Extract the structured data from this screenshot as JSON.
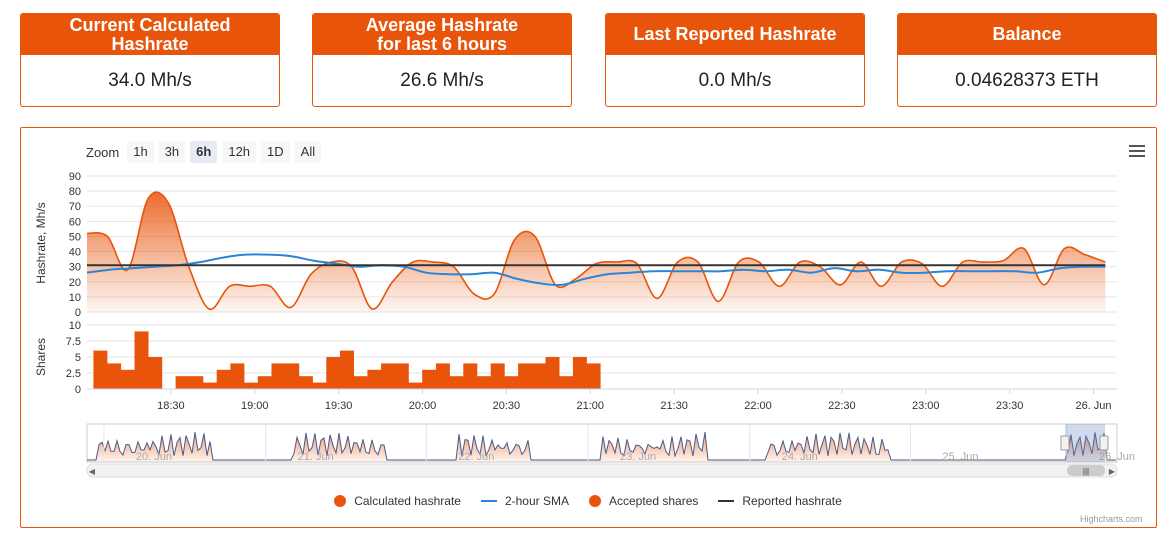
{
  "stats": [
    {
      "title": "Current Calculated\nHashrate",
      "value": "34.0 Mh/s"
    },
    {
      "title": "Average Hashrate\nfor last 6 hours",
      "value": "26.6 Mh/s"
    },
    {
      "title": "Last Reported Hashrate",
      "value": "0.0 Mh/s"
    },
    {
      "title": "Balance",
      "value": "0.04628373 ETH"
    }
  ],
  "zoom": {
    "label": "Zoom",
    "buttons": [
      "1h",
      "3h",
      "6h",
      "12h",
      "1D",
      "All"
    ],
    "selected": "6h"
  },
  "colors": {
    "accent": "#e8540a",
    "sma": "#2a85d8",
    "reported": "#333333"
  },
  "chart_data": {
    "type": "area",
    "x_ticks": [
      "18:30",
      "19:00",
      "19:30",
      "20:00",
      "20:30",
      "21:00",
      "21:30",
      "22:00",
      "22:30",
      "23:00",
      "23:30",
      "26. Jun"
    ],
    "hashrate_panel": {
      "ylabel": "Hashrate, Mh/s",
      "ylim": [
        0,
        90
      ],
      "yticks": [
        0,
        10,
        20,
        30,
        40,
        50,
        60,
        70,
        80,
        90
      ],
      "x_hours": [
        18.07,
        18.23,
        18.42,
        18.53,
        18.63,
        18.75,
        18.87,
        18.97,
        19.05,
        19.15,
        19.33,
        19.5,
        19.58,
        19.75,
        19.92,
        20.1,
        20.27,
        20.38,
        20.5,
        20.63,
        20.75,
        20.87,
        20.97,
        21.05,
        21.12,
        21.22,
        21.33,
        21.4,
        21.53,
        21.67,
        21.75,
        21.83,
        21.95,
        22.05,
        22.13,
        22.2,
        22.3,
        22.42,
        22.47,
        22.58,
        22.67,
        22.75,
        22.87,
        22.93,
        23.05,
        23.17,
        23.22,
        23.35,
        23.45,
        23.55,
        23.67,
        23.73,
        23.83,
        23.92,
        23.97,
        24.07
      ],
      "series": [
        {
          "name": "Calculated hashrate",
          "values": [
            52,
            50,
            28,
            75,
            72,
            30,
            2,
            17,
            17,
            17,
            3,
            25,
            33,
            30,
            2,
            20,
            33,
            33,
            30,
            12,
            12,
            48,
            50,
            18,
            22,
            32,
            33,
            32,
            9,
            33,
            33,
            7,
            33,
            33,
            17,
            33,
            30,
            18,
            33,
            17,
            33,
            32,
            17,
            33,
            33,
            34,
            42,
            18,
            42,
            38,
            33
          ]
        },
        {
          "name": "2-hour SMA",
          "values": [
            26,
            28,
            29,
            30,
            31,
            33,
            36,
            38,
            38,
            37,
            34,
            32,
            30,
            31,
            30,
            26,
            25,
            25,
            26,
            22,
            19,
            18,
            22,
            25,
            26,
            27,
            27,
            27,
            27,
            28,
            27,
            28,
            26,
            29,
            27,
            28,
            26,
            26,
            27,
            27,
            27,
            27,
            26,
            29,
            30,
            30
          ]
        },
        {
          "name": "Reported hashrate",
          "values": [
            31,
            31,
            31,
            31,
            31,
            31,
            31,
            31,
            31,
            31,
            31,
            31,
            31,
            31,
            31,
            31,
            31,
            31,
            31,
            31,
            31
          ]
        }
      ]
    },
    "shares_panel": {
      "ylabel": "Shares",
      "ylim": [
        0,
        10
      ],
      "yticks": [
        0,
        2.5,
        5,
        7.5,
        10
      ],
      "series_name": "Accepted shares",
      "values": [
        6,
        4,
        3,
        9,
        5,
        0,
        2,
        2,
        1,
        3,
        4,
        1,
        2,
        4,
        4,
        2,
        1,
        5,
        6,
        2,
        3,
        4,
        4,
        1,
        3,
        4,
        2,
        4,
        2,
        4,
        2,
        4,
        4,
        5,
        2,
        5,
        4
      ]
    },
    "navigator_labels": [
      "20. Jun",
      "21. Jun",
      "22. Jun",
      "23. Jun",
      "24. Jun",
      "25. Jun",
      "26. Jun"
    ],
    "legend": [
      "Calculated hashrate",
      "2-hour SMA",
      "Accepted shares",
      "Reported hashrate"
    ],
    "credit": "Highcharts.com"
  }
}
